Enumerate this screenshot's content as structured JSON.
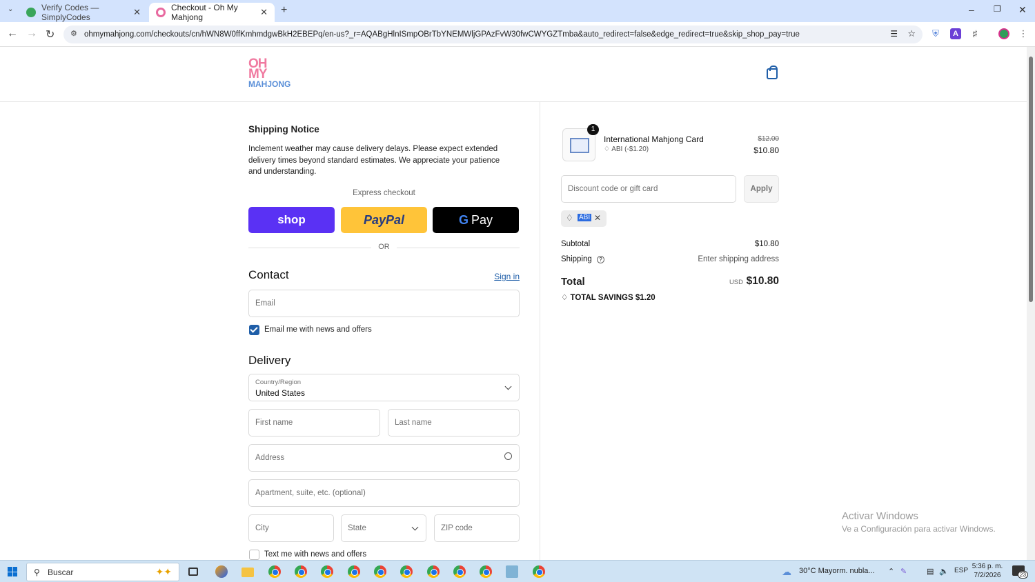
{
  "browser": {
    "tabs": [
      {
        "title": "Verify Codes — SimplyCodes",
        "active": false
      },
      {
        "title": "Checkout - Oh My Mahjong",
        "active": true
      }
    ],
    "url": "ohmymahjong.com/checkouts/cn/hWN8W0ffKmhmdgwBkH2EBEPq/en-us?_r=AQABgHlnISmpOBrTbYNEMWljGPAzFvW30fwCWYGZTmba&auto_redirect=false&edge_redirect=true&skip_shop_pay=true"
  },
  "logo": {
    "line1": "OH",
    "line2": "MY",
    "line3": "MAHJONG"
  },
  "notice": {
    "title": "Shipping Notice",
    "body": "Inclement weather may cause delivery delays. Please expect extended delivery times beyond standard estimates. We appreciate your patience and understanding."
  },
  "express": {
    "label": "Express checkout",
    "shop": "shop",
    "paypal": "PayPal",
    "gpay": "Pay",
    "or": "OR"
  },
  "contact": {
    "title": "Contact",
    "signin": "Sign in",
    "email_placeholder": "Email",
    "news_label": "Email me with news and offers",
    "news_checked": true
  },
  "delivery": {
    "title": "Delivery",
    "country_label": "Country/Region",
    "country_value": "United States",
    "first_name": "First name",
    "last_name": "Last name",
    "address": "Address",
    "apartment": "Apartment, suite, etc. (optional)",
    "city": "City",
    "state": "State",
    "zip": "ZIP code",
    "text_label": "Text me with news and offers"
  },
  "summary": {
    "item": {
      "qty": "1",
      "name": "International Mahjong Card",
      "discount": "ABI (-$1.20)",
      "old_price": "$12.00",
      "price": "$10.80"
    },
    "discount_placeholder": "Discount code or gift card",
    "apply": "Apply",
    "applied_code": "ABI",
    "subtotal_label": "Subtotal",
    "subtotal": "$10.80",
    "shipping_label": "Shipping",
    "shipping": "Enter shipping address",
    "total_label": "Total",
    "currency": "USD",
    "total": "$10.80",
    "savings": "TOTAL SAVINGS  $1.20"
  },
  "watermark": {
    "title": "Activar Windows",
    "sub": "Ve a Configuración para activar Windows."
  },
  "taskbar": {
    "search": "Buscar",
    "weather": "30°C  Mayorm. nubla...",
    "lang": "ESP",
    "time": "5:36 p. m.",
    "date": "7/2/2026",
    "notif": "23"
  }
}
